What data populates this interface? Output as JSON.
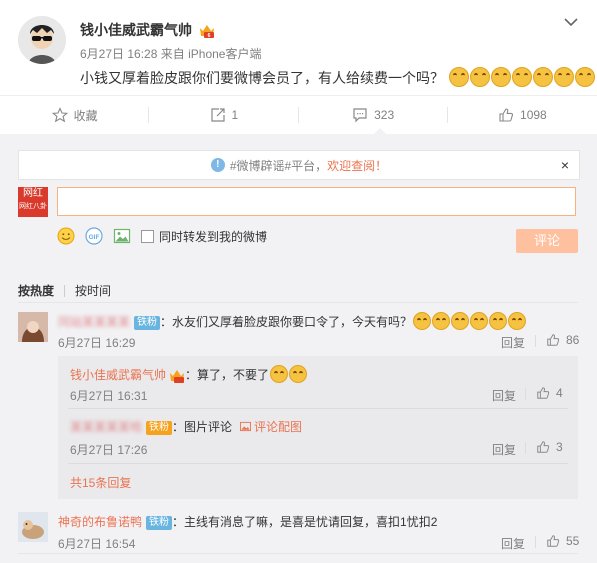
{
  "post": {
    "author": "钱小佳威武霸气帅",
    "time": "6月27日 16:28",
    "source_prefix": "来自",
    "source": "iPhone客户端",
    "text": "小钱又厚着脸皮跟你们要微博会员了，有人给续费一个吗？",
    "emoji_count": 7
  },
  "actions": {
    "favorite_label": "收藏",
    "repost_count": "1",
    "comment_count": "323",
    "like_count": "1098"
  },
  "notice": {
    "prefix": "#微博辟谣#平台，",
    "link": "欢迎查阅！",
    "close": "×"
  },
  "composer": {
    "avatar_top": "网红",
    "avatar_bottom": "网红八卦",
    "input_value": "",
    "sync_label": "同时转发到我的微博",
    "submit_label": "评论"
  },
  "sort": {
    "hot_label": "按热度",
    "time_label": "按时间"
  },
  "comments": [
    {
      "name": "冈站某某某某",
      "badge": "铁粉",
      "text": "：水友们又厚着脸皮跟你要口令了，今天有吗？",
      "emoji_count": 6,
      "time": "6月27日 16:29",
      "reply_label": "回复",
      "likes": "86"
    },
    {
      "name": "神奇的布鲁诺鸭",
      "badge": "铁粉",
      "text": "：主线有消息了嘛，是喜是忧请回复，喜扣1忧扣2",
      "time": "6月27日 16:54",
      "reply_label": "回复",
      "likes": "55"
    }
  ],
  "replies": [
    {
      "name": "钱小佳威武霸气帅",
      "text": "：算了，不要了",
      "emoji_count": 2,
      "time": "6月27日 16:31",
      "reply_label": "回复",
      "likes": "4"
    },
    {
      "name": "某某某某某哈",
      "badge": "铁粉",
      "text": "：图片评论",
      "pic_label": "评论配图",
      "time": "6月27日 17:26",
      "reply_label": "回复",
      "likes": "3"
    }
  ],
  "more_replies": "共15条回复",
  "colors": {
    "accent": "#eb7350",
    "fan_badge": "#69b5e0",
    "submit_disabled": "#ffc09f"
  }
}
